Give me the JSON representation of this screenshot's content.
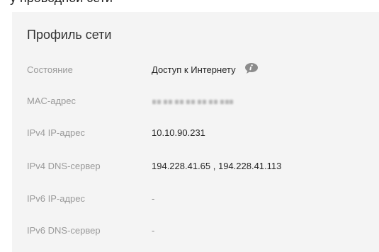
{
  "header_partial_text": "у проводной сети",
  "profile": {
    "title": "Профиль сети",
    "rows": [
      {
        "label": "Состояние",
        "value": "Доступ к Интернету"
      },
      {
        "label": "MAC-адрес",
        "value": ""
      },
      {
        "label": "IPv4 IP-адрес",
        "value": "10.10.90.231"
      },
      {
        "label": "IPv4 DNS-сервер",
        "value": "194.228.41.65 , 194.228.41.113"
      },
      {
        "label": "IPv6 IP-адрес",
        "value": "-"
      },
      {
        "label": "IPv6 DNS-сервер",
        "value": "-"
      }
    ],
    "status_info_icon": "info-speech-bubble-icon"
  },
  "colors": {
    "card_background": "#f4f4f4",
    "label_text": "#9a9a9a",
    "value_text": "#262626",
    "icon": "#8c8c8c"
  }
}
